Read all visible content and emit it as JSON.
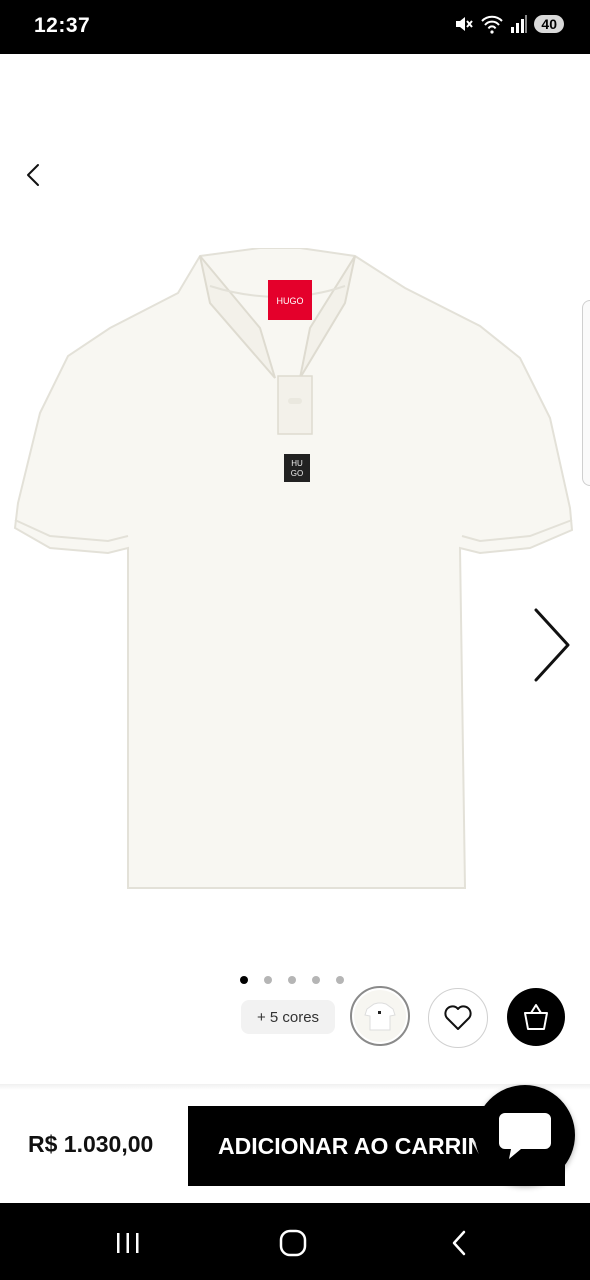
{
  "status_bar": {
    "time": "12:37",
    "battery": "40",
    "icons": [
      "mute-icon",
      "wifi-icon",
      "signal-icon",
      "battery-icon"
    ]
  },
  "product": {
    "image": "white-polo-shirt",
    "logo_text": "HUGO",
    "badge_text_top": "HU",
    "badge_text_bottom": "GO"
  },
  "carousel": {
    "dot_count": 5,
    "active_index": 0
  },
  "colors": {
    "more_label": "+ 5 cores"
  },
  "purchase": {
    "price": "R$ 1.030,00",
    "add_to_cart_label": "ADICIONAR AO CARRINHO"
  },
  "theme": {
    "background": "#ffffff",
    "accent": "#000000",
    "shirt": "#f8f7f2",
    "label_red": "#e4002b"
  }
}
